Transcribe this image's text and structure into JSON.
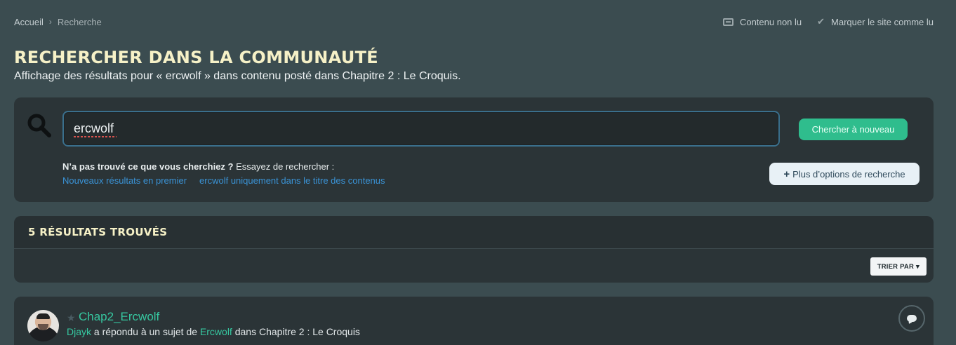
{
  "breadcrumb": {
    "items": [
      "Accueil",
      "Recherche"
    ],
    "separator": "›"
  },
  "top_actions": {
    "unread": "Contenu non lu",
    "mark_read": "Marquer le site comme lu"
  },
  "page": {
    "title": "RECHERCHER DANS LA COMMUNAUTÉ",
    "subtitle": "Affichage des résultats pour « ercwolf » dans contenu posté dans Chapitre 2 : Le Croquis."
  },
  "search": {
    "value": "ercwolf",
    "submit_label": "Chercher à nouveau",
    "hint_bold": "N’a pas trouvé ce que vous cherchiez ?",
    "hint_rest": " Essayez de rechercher :",
    "suggestions": [
      "Nouveaux résultats en premier",
      "ercwolf uniquement dans le titre des contenus"
    ],
    "more_options_label": "Plus d’options de recherche"
  },
  "results": {
    "count_label": "5 RÉSULTATS TROUVÉS",
    "sort_label": "TRIER PAR"
  },
  "result_items": [
    {
      "title": "Chap2_Ercwolf",
      "author": "Djayk",
      "action": " a répondu à un sujet de ",
      "topic_author": "Ercwolf",
      "location": " dans Chapitre 2 : Le Croquis"
    }
  ],
  "colors": {
    "background": "#3b4c50",
    "panel": "#2b3437",
    "accent_green": "#2fbd8d",
    "link_blue": "#3a93d6",
    "title_cream": "#f6f1c7"
  }
}
